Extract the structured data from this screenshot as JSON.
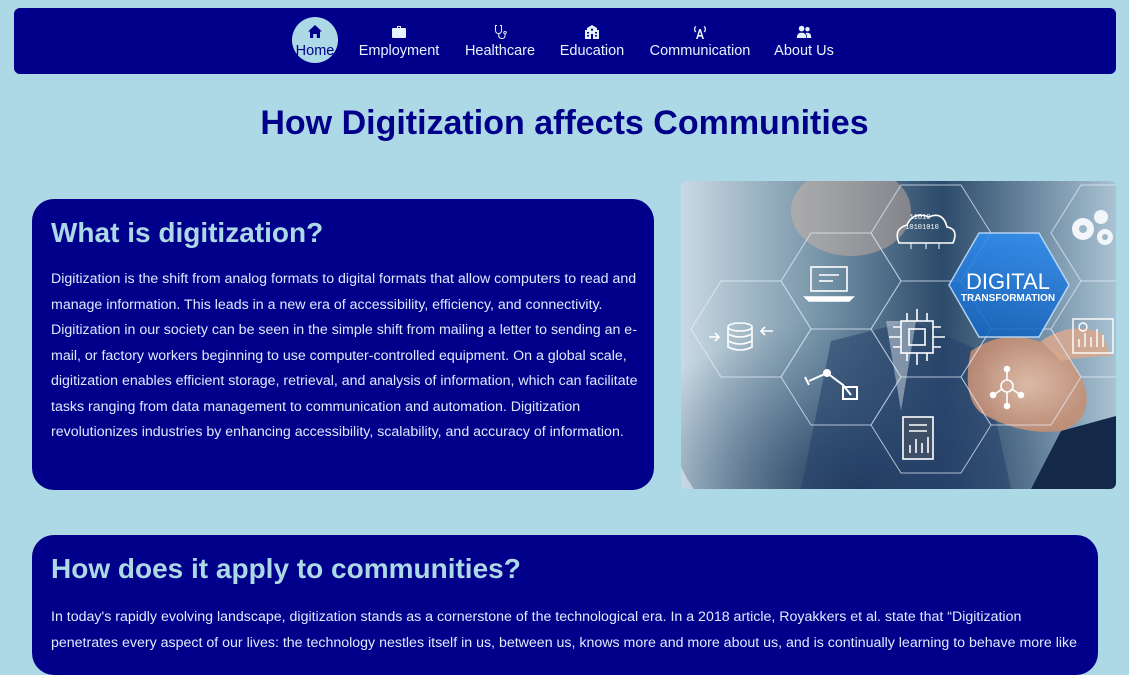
{
  "nav": {
    "items": [
      {
        "label": "Home",
        "icon": "home-icon"
      },
      {
        "label": "Employment",
        "icon": "briefcase-icon"
      },
      {
        "label": "Healthcare",
        "icon": "stethoscope-icon"
      },
      {
        "label": "Education",
        "icon": "school-icon"
      },
      {
        "label": "Communication",
        "icon": "broadcast-tower-icon"
      },
      {
        "label": "About Us",
        "icon": "users-icon"
      }
    ],
    "active": "Home"
  },
  "page": {
    "title": "How Digitization affects Communities"
  },
  "section1": {
    "heading": "What is digitization?",
    "body": "Digitization is the shift from analog formats to digital formats that allow computers to read and manage information. This leads in a new era of accessibility, efficiency, and connectivity. Digitization in our society can be seen in the simple shift from mailing a letter to sending an e-mail, or factory workers beginning to use computer-controlled equipment. On a global scale, digitization enables efficient storage, retrieval, and analysis of information, which can facilitate tasks ranging from data management to communication and automation. Digitization revolutionizes industries by enhancing accessibility, scalability, and accuracy of information."
  },
  "hero_image": {
    "headline": "DIGITAL",
    "subline": "TRANSFORMATION",
    "binary_top": "11010",
    "binary_bottom": "10101010"
  },
  "section2": {
    "heading": "How does it apply to communities?",
    "body": "In today's rapidly evolving landscape, digitization stands as a cornerstone of the technological era. In a 2018 article, Royakkers et al. state that “Digitization penetrates every aspect of our lives: the technology nestles itself in us, between us, knows more and more about us, and is continually learning to behave more like"
  },
  "colors": {
    "background": "#add8e6",
    "primary": "#00008b",
    "heading_on_dark": "#add8e6"
  }
}
